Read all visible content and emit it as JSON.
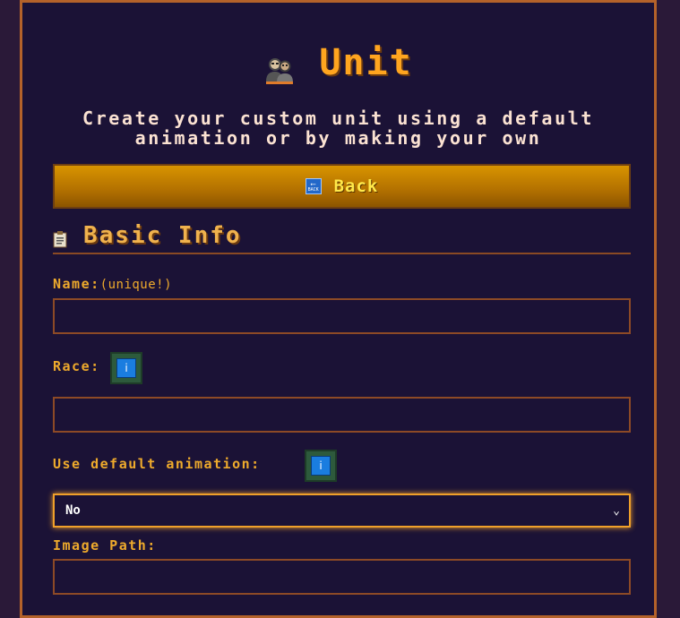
{
  "header": {
    "title": "Unit",
    "icon": "users-icon"
  },
  "subtitle": {
    "line1": "Create your custom unit using a default",
    "line2": "animation or by making your own"
  },
  "back_button": {
    "label": "Back",
    "icon": "back-arrow-icon"
  },
  "section": {
    "title": "Basic Info",
    "icon": "clipboard-icon"
  },
  "form": {
    "name_label": "Name:",
    "name_hint": "(unique!)",
    "name_value": "",
    "race_label": "Race:",
    "race_value": "",
    "anim_label": "Use default animation:",
    "anim_selected": "No",
    "image_label": "Image Path:",
    "image_value": "",
    "info_glyph": "i"
  },
  "colors": {
    "accent": "#ffa51f",
    "panel_bg": "#1b1236",
    "border": "#b4622a",
    "button": "#b27000",
    "info_button": "#1a7de0"
  }
}
